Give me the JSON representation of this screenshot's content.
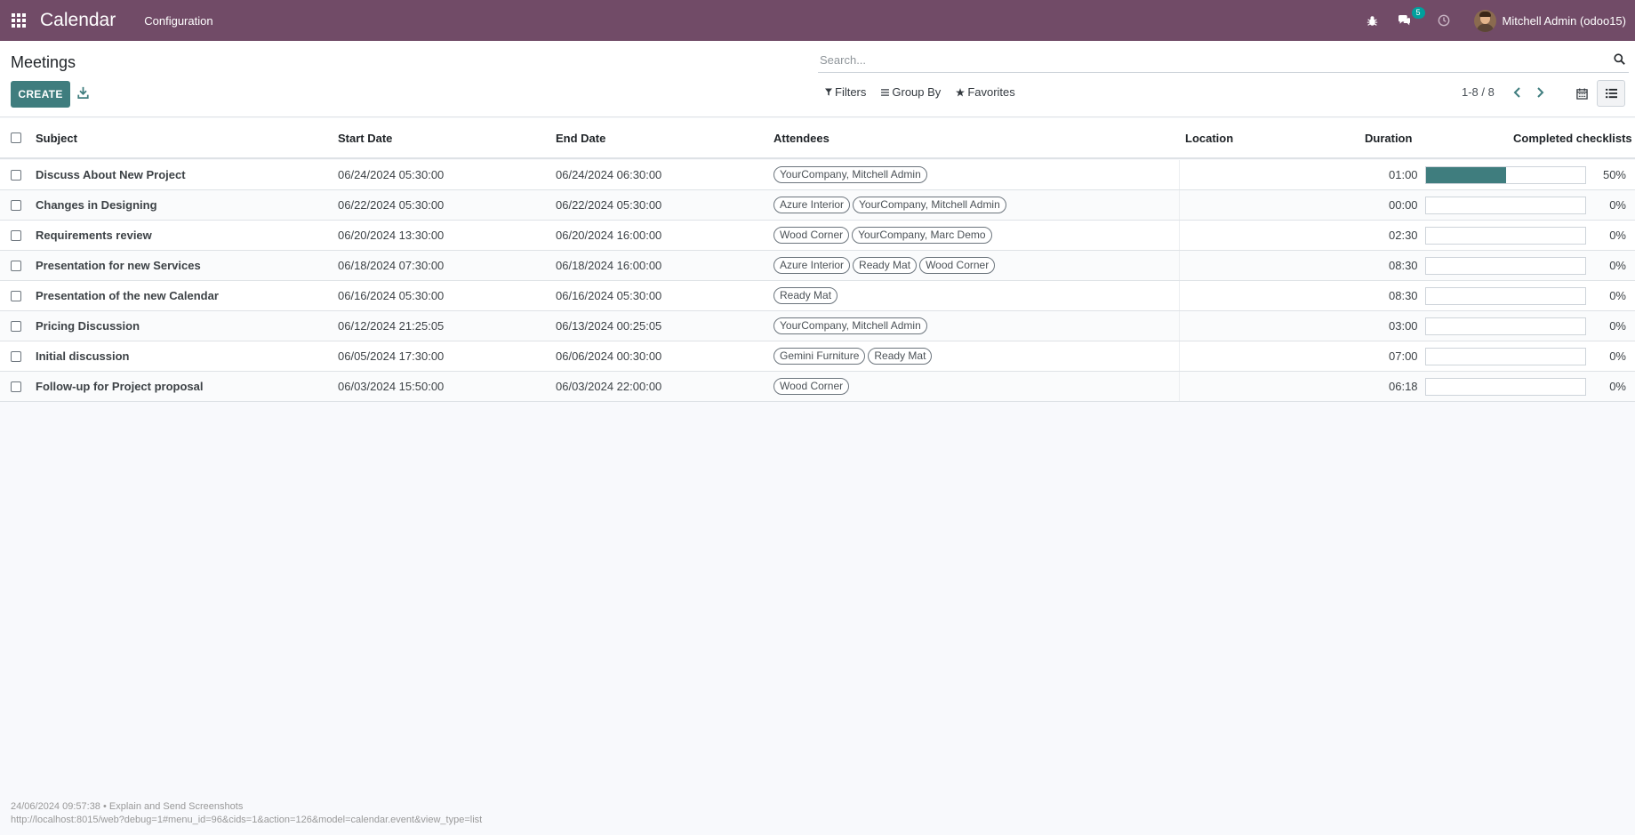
{
  "navbar": {
    "app_name": "Calendar",
    "menu": [
      "Configuration"
    ],
    "messages_badge": "5",
    "user_name": "Mitchell Admin (odoo15)",
    "bg_color": "#714b67"
  },
  "control_panel": {
    "breadcrumb": "Meetings",
    "create_label": "CREATE",
    "search_placeholder": "Search...",
    "filters_label": "Filters",
    "group_by_label": "Group By",
    "favorites_label": "Favorites",
    "pager": "1-8 / 8",
    "accent_color": "#3f7d7e"
  },
  "table": {
    "headers": {
      "subject": "Subject",
      "start": "Start Date",
      "end": "End Date",
      "attendees": "Attendees",
      "location": "Location",
      "duration": "Duration",
      "checklists": "Completed checklists"
    },
    "rows": [
      {
        "subject": "Discuss About New Project",
        "start": "06/24/2024 05:30:00",
        "end": "06/24/2024 06:30:00",
        "attendees": [
          "YourCompany, Mitchell Admin"
        ],
        "location": "",
        "duration": "01:00",
        "progress": 50,
        "progress_label": "50%"
      },
      {
        "subject": "Changes in Designing",
        "start": "06/22/2024 05:30:00",
        "end": "06/22/2024 05:30:00",
        "attendees": [
          "Azure Interior",
          "YourCompany, Mitchell Admin"
        ],
        "location": "",
        "duration": "00:00",
        "progress": 0,
        "progress_label": "0%"
      },
      {
        "subject": "Requirements review",
        "start": "06/20/2024 13:30:00",
        "end": "06/20/2024 16:00:00",
        "attendees": [
          "Wood Corner",
          "YourCompany, Marc Demo"
        ],
        "location": "",
        "duration": "02:30",
        "progress": 0,
        "progress_label": "0%"
      },
      {
        "subject": "Presentation for new Services",
        "start": "06/18/2024 07:30:00",
        "end": "06/18/2024 16:00:00",
        "attendees": [
          "Azure Interior",
          "Ready Mat",
          "Wood Corner"
        ],
        "location": "",
        "duration": "08:30",
        "progress": 0,
        "progress_label": "0%"
      },
      {
        "subject": "Presentation of the new Calendar",
        "start": "06/16/2024 05:30:00",
        "end": "06/16/2024 05:30:00",
        "attendees": [
          "Ready Mat"
        ],
        "location": "",
        "duration": "08:30",
        "progress": 0,
        "progress_label": "0%"
      },
      {
        "subject": "Pricing Discussion",
        "start": "06/12/2024 21:25:05",
        "end": "06/13/2024 00:25:05",
        "attendees": [
          "YourCompany, Mitchell Admin"
        ],
        "location": "",
        "duration": "03:00",
        "progress": 0,
        "progress_label": "0%"
      },
      {
        "subject": "Initial discussion",
        "start": "06/05/2024 17:30:00",
        "end": "06/06/2024 00:30:00",
        "attendees": [
          "Gemini Furniture",
          "Ready Mat"
        ],
        "location": "",
        "duration": "07:00",
        "progress": 0,
        "progress_label": "0%"
      },
      {
        "subject": "Follow-up for Project proposal",
        "start": "06/03/2024 15:50:00",
        "end": "06/03/2024 22:00:00",
        "attendees": [
          "Wood Corner"
        ],
        "location": "",
        "duration": "06:18",
        "progress": 0,
        "progress_label": "0%"
      }
    ]
  },
  "footer": {
    "timestamp_line": "24/06/2024 09:57:38 • Explain and Send Screenshots",
    "url_line": "http://localhost:8015/web?debug=1#menu_id=96&cids=1&action=126&model=calendar.event&view_type=list"
  }
}
